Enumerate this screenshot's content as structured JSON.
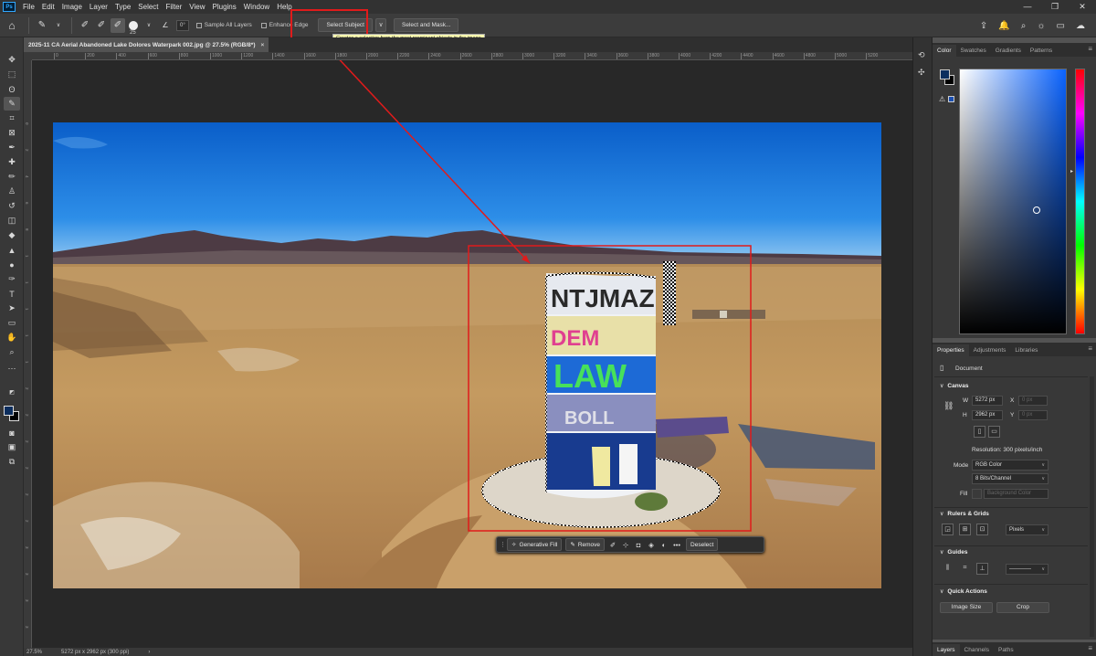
{
  "menu": {
    "logo": "Ps",
    "items": [
      "File",
      "Edit",
      "Image",
      "Layer",
      "Type",
      "Select",
      "Filter",
      "View",
      "Plugins",
      "Window",
      "Help"
    ],
    "win_min": "—",
    "win_max": "❐",
    "win_close": "✕"
  },
  "options": {
    "brush_size": "25",
    "angle": "0°",
    "sample_all_layers": "Sample All Layers",
    "enhance_edge": "Enhance Edge",
    "select_subject": "Select Subject",
    "select_and_mask": "Select and Mask...",
    "tooltip": "Creates a selection from the most prominent objects in the image"
  },
  "document": {
    "tab_title": "2025-11 CA Aerial Abandoned Lake Dolores Waterpark 002.jpg @ 27.5% (RGB/8*)",
    "close": "×"
  },
  "ruler": {
    "top_ticks": [
      "0",
      "200",
      "400",
      "600",
      "800",
      "1000",
      "1200",
      "1400",
      "1600",
      "1800",
      "2000",
      "2200",
      "2400",
      "2600",
      "2800",
      "3000",
      "3200",
      "3400",
      "3600",
      "3800",
      "4000",
      "4200",
      "4400",
      "4600",
      "4800",
      "5000",
      "5200"
    ],
    "left_ticks": [
      "0",
      "2",
      "4",
      "6",
      "8",
      "1",
      "1",
      "1",
      "1",
      "1",
      "2",
      "2",
      "2",
      "2",
      "2",
      "2",
      "3",
      "3",
      "3",
      "3",
      "3",
      "3"
    ]
  },
  "status": {
    "zoom": "27.5%",
    "doc_info": "5272 px x 2962 px (300 ppi)",
    "arrow": "›"
  },
  "taskbar": {
    "grip": "⋮",
    "generative_fill": "Generative Fill",
    "remove": "Remove",
    "more": "•••",
    "deselect": "Deselect"
  },
  "color_panel": {
    "tabs": [
      "Color",
      "Swatches",
      "Gradients",
      "Patterns"
    ],
    "foreground": "#0c2e5e",
    "background": "#000000",
    "gamut_warning": "⚠"
  },
  "properties": {
    "tabs": [
      "Properties",
      "Adjustments",
      "Libraries"
    ],
    "doc_label": "Document",
    "canvas": {
      "title": "Canvas",
      "w_label": "W",
      "w_value": "5272 px",
      "h_label": "H",
      "h_value": "2962 px",
      "x_label": "X",
      "x_value": "0 px",
      "y_label": "Y",
      "y_value": "0 px",
      "resolution": "Resolution: 300 pixels/inch",
      "mode_label": "Mode",
      "mode_value": "RGB Color",
      "depth_value": "8 Bits/Channel",
      "fill_label": "Fill",
      "fill_value": "Background Color"
    },
    "rulers_grids": {
      "title": "Rulers & Grids",
      "units": "Pixels"
    },
    "guides": {
      "title": "Guides",
      "line": "————"
    },
    "quick_actions": {
      "title": "Quick Actions",
      "image_size": "Image Size",
      "crop": "Crop"
    }
  },
  "layers": {
    "tabs": [
      "Layers",
      "Channels",
      "Paths"
    ]
  },
  "photo": {
    "graffiti_top": "NTJMAZ",
    "graffiti_mid": "DEM",
    "graffiti_big": "LAW",
    "graffiti_low": "BOLL"
  }
}
